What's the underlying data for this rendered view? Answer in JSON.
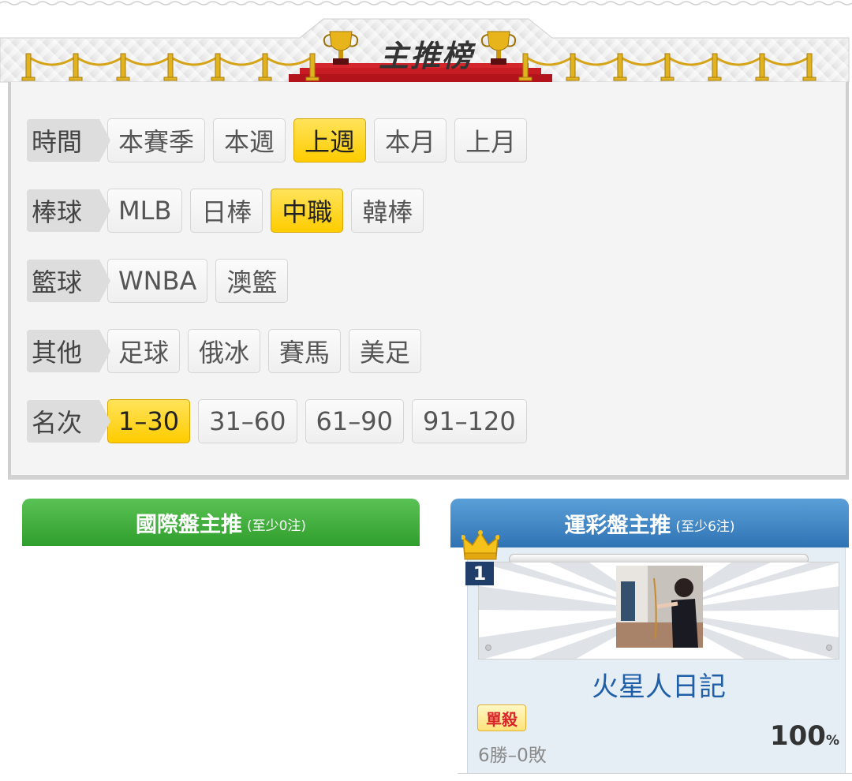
{
  "banner": {
    "title": "主推榜",
    "icons": [
      "trophy-icon",
      "trophy-icon",
      "stanchion-rope-icon"
    ],
    "colors": {
      "carpet": "#b3141b",
      "gold": "#e2b320",
      "background": "#eeeeee"
    }
  },
  "filters": {
    "rows": [
      {
        "label": "時間",
        "options": [
          "本賽季",
          "本週",
          "上週",
          "本月",
          "上月"
        ],
        "active": "上週"
      },
      {
        "label": "棒球",
        "options": [
          "MLB",
          "日棒",
          "中職",
          "韓棒"
        ],
        "active": "中職"
      },
      {
        "label": "籃球",
        "options": [
          "WNBA",
          "澳籃"
        ],
        "active": ""
      },
      {
        "label": "其他",
        "options": [
          "足球",
          "俄冰",
          "賽馬",
          "美足"
        ],
        "active": ""
      },
      {
        "label": "名次",
        "options": [
          "1–30",
          "31–60",
          "61–90",
          "91–120"
        ],
        "active": "1–30"
      }
    ],
    "active_color": "#ffd11a"
  },
  "international": {
    "title": "國際盤主推",
    "subtitle": "(至少0注)",
    "color": "#3aa838"
  },
  "lottery": {
    "title": "運彩盤主推",
    "subtitle": "(至少6注)",
    "color": "#3d82c2",
    "top_pick": {
      "rank": "1",
      "name": "火星人日記",
      "tag": "單殺",
      "record": "6勝–0敗",
      "win_rate": "100",
      "win_rate_unit": "%",
      "icons": [
        "crown-icon",
        "avatar-photo"
      ]
    }
  }
}
